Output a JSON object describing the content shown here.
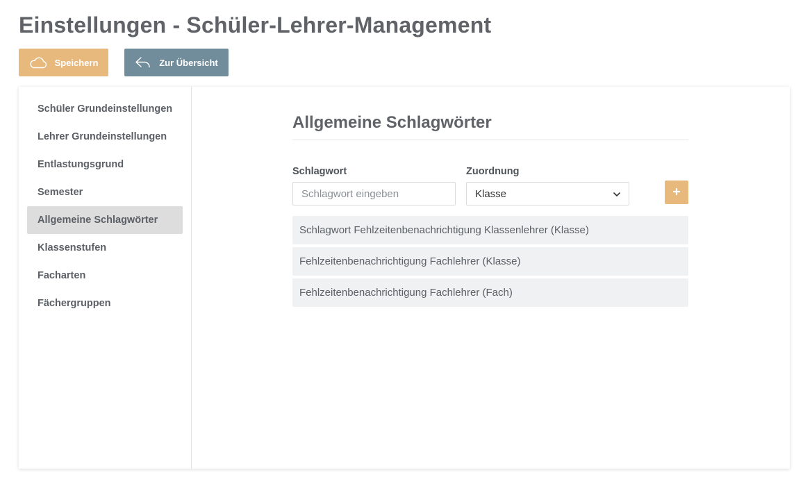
{
  "page": {
    "title": "Einstellungen - Schüler-Lehrer-Management"
  },
  "toolbar": {
    "save_label": "Speichern",
    "back_label": "Zur Übersicht",
    "save_color": "#e8b97d",
    "back_color": "#718c9b"
  },
  "sidebar": {
    "items": [
      {
        "label": "Schüler Grundeinstellungen",
        "active": false
      },
      {
        "label": "Lehrer Grundeinstellungen",
        "active": false
      },
      {
        "label": "Entlastungsgrund",
        "active": false
      },
      {
        "label": "Semester",
        "active": false
      },
      {
        "label": "Allgemeine Schlagwörter",
        "active": true
      },
      {
        "label": "Klassenstufen",
        "active": false
      },
      {
        "label": "Facharten",
        "active": false
      },
      {
        "label": "Fächergruppen",
        "active": false
      }
    ]
  },
  "main": {
    "section_title": "Allgemeine Schlagwörter",
    "form": {
      "keyword_label": "Schlagwort",
      "keyword_placeholder": "Schlagwort eingeben",
      "keyword_value": "",
      "assignment_label": "Zuordnung",
      "assignment_value": "Klasse"
    },
    "add_icon": "plus-icon",
    "tags": [
      "Schlagwort Fehlzeitenbenachrichtigung Klassenlehrer (Klasse)",
      "Fehlzeitenbenachrichtigung Fachlehrer (Klasse)",
      "Fehlzeitenbenachrichtigung Fachlehrer (Fach)"
    ]
  },
  "icons": {
    "save": "cloud-icon",
    "back": "reply-arrow-icon",
    "select": "chevron-down-icon"
  }
}
